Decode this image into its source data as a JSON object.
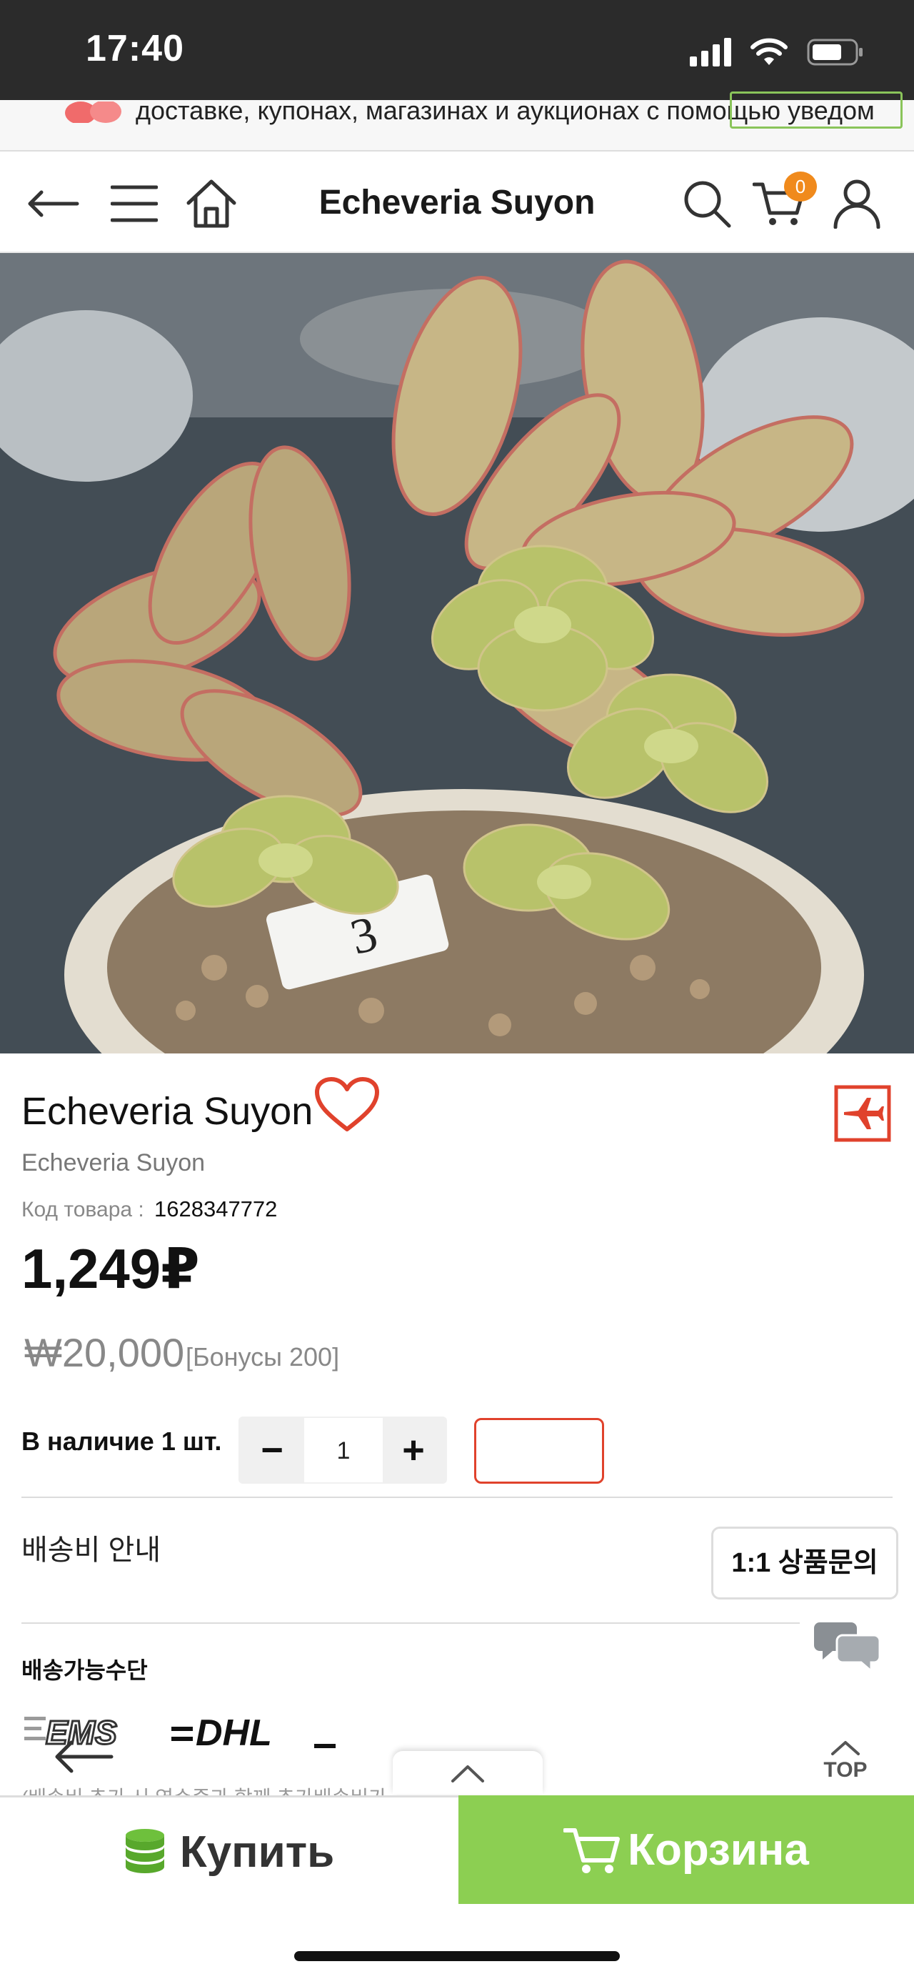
{
  "status_bar": {
    "time": "17:40"
  },
  "banner": {
    "text": "доставке, купонах, магазинах и аукционах с помощью уведом"
  },
  "header": {
    "title": "Echeveria Suyon",
    "cart_count": "0",
    "icons": [
      "back-arrow-icon",
      "menu-icon",
      "home-icon",
      "search-icon",
      "cart-icon",
      "user-icon"
    ]
  },
  "product": {
    "name": "Echeveria Suyon",
    "subtitle": "Echeveria Suyon",
    "code_label": "Код товара :",
    "code_value": "1628347772",
    "price": "1,249₽",
    "krw_price": "₩20,000",
    "bonus": "[Бонусы 200]",
    "stock": "В наличие 1 шт.",
    "qty_minus": "−",
    "qty_value": "1",
    "qty_plus": "+",
    "pot_label": "3"
  },
  "shipping": {
    "info": "배송비 안내",
    "inquiry_button": "1:1 상품문의",
    "methods_title": "배송가능수단",
    "carriers": [
      "EMS",
      "DHL"
    ],
    "note_partial": "(배송비 추가 시 영수증과 함께 추가배송비가"
  },
  "bottom_bar": {
    "buy_label": "Купить",
    "cart_label": "Корзина",
    "top_label": "TOP"
  },
  "colors": {
    "accent_green": "#8ccf52",
    "badge_orange": "#f08a1c",
    "heart_red": "#e0422c"
  }
}
